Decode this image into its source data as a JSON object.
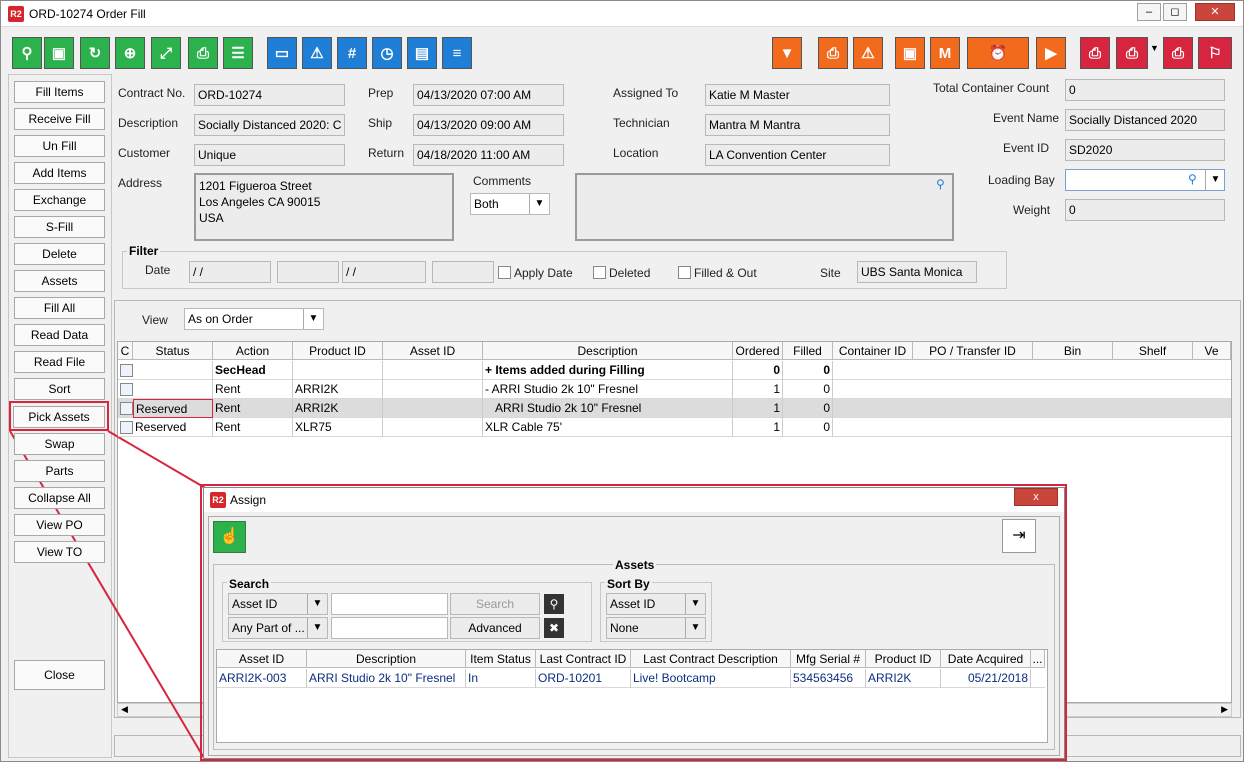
{
  "window": {
    "title": "ORD-10274 Order Fill",
    "logo": "R2"
  },
  "toolbar": {
    "left_icons": [
      "search-icon",
      "hand-truck-icon",
      "refresh-icon",
      "zoom-in-icon",
      "expand-icon",
      "print-icon",
      "layers-icon",
      "tablet-icon",
      "warning-eye-icon",
      "hash-icon",
      "gauge-icon",
      "comment-icon",
      "list-icon"
    ],
    "right_icons": [
      "filter-icon",
      "print-icon",
      "print-warning-icon",
      "box-warning-icon",
      "box-m-icon",
      "truck-clock-icon",
      "truck-icon",
      "print-red-icon",
      "print-red-2-icon",
      "print-red-3-icon",
      "print-tag-icon"
    ],
    "hash_glyph": "#"
  },
  "sidebar": {
    "items": [
      "Fill Items",
      "Receive Fill",
      "Un Fill",
      "Add Items",
      "Exchange",
      "S-Fill",
      "Delete",
      "Assets",
      "Fill  All",
      "Read Data",
      "Read File",
      "Sort",
      "Pick Assets",
      "Swap",
      "Parts",
      "Collapse All",
      "View PO",
      "View TO"
    ],
    "close": "Close"
  },
  "form": {
    "contract_no_label": "Contract No.",
    "contract_no": "ORD-10274",
    "description_label": "Description",
    "description": "Socially Distanced 2020: C",
    "customer_label": "Customer",
    "customer": "Unique",
    "address_label": "Address",
    "address_lines": [
      "1201 Figueroa Street",
      "Los Angeles CA 90015",
      "USA"
    ],
    "prep_label": "Prep",
    "prep": "04/13/2020 07:00 AM",
    "ship_label": "Ship",
    "ship": "04/13/2020 09:00 AM",
    "return_label": "Return",
    "return": "04/18/2020 11:00 AM",
    "comments_label": "Comments",
    "comments_select": "Both",
    "assigned_to_label": "Assigned To",
    "assigned_to": "Katie M Master",
    "technician_label": "Technician",
    "technician": "Mantra M Mantra",
    "location_label": "Location",
    "location": "LA Convention Center",
    "total_container_label": "Total Container Count",
    "total_container": "0",
    "event_name_label": "Event Name",
    "event_name": "Socially Distanced 2020",
    "event_id_label": "Event ID",
    "event_id": "SD2020",
    "loading_bay_label": "Loading Bay",
    "loading_bay": "",
    "weight_label": "Weight",
    "weight": "0"
  },
  "filter": {
    "title": "Filter",
    "date_label": "Date",
    "date_from": "/ /",
    "date_to": "/ /",
    "apply_date": "Apply Date",
    "deleted": "Deleted",
    "filled_out": "Filled & Out",
    "site_label": "Site",
    "site": "UBS Santa Monica"
  },
  "grid": {
    "view_label": "View",
    "view_value": "As on Order",
    "columns": [
      "C",
      "Status",
      "Action",
      "Product ID",
      "Asset ID",
      "Description",
      "Ordered",
      "Filled",
      "Container ID",
      "PO / Transfer ID",
      "Bin",
      "Shelf",
      "Ve"
    ],
    "rows": [
      {
        "status": "",
        "action": "SecHead",
        "product": "",
        "asset": "",
        "desc": "+ Items added during Filling",
        "ordered": "0",
        "filled": "0",
        "bold": true
      },
      {
        "status": "",
        "action": "Rent",
        "product": "ARRI2K",
        "asset": "",
        "desc": "- ARRI Studio 2k 10\" Fresnel",
        "ordered": "1",
        "filled": "0"
      },
      {
        "status": "Reserved",
        "action": "Rent",
        "product": "ARRI2K",
        "asset": "",
        "desc": "   ARRI Studio 2k 10\" Fresnel",
        "ordered": "1",
        "filled": "0",
        "selected": true
      },
      {
        "status": "Reserved",
        "action": "Rent",
        "product": "XLR75",
        "asset": "",
        "desc": "XLR Cable 75'",
        "ordered": "1",
        "filled": "0"
      }
    ]
  },
  "assign": {
    "title": "Assign",
    "logo": "R2",
    "close_glyph": "x",
    "assets_label": "Assets",
    "search_label": "Search",
    "search_field1": "Asset ID",
    "search_field2": "Any Part of ...",
    "search_btn": "Search",
    "advanced_btn": "Advanced",
    "sort_label": "Sort By",
    "sort1": "Asset ID",
    "sort2": "None",
    "columns": [
      "Asset ID",
      "Description",
      "Item Status",
      "Last Contract ID",
      "Last Contract Description",
      "Mfg Serial #",
      "Product ID",
      "Date Acquired",
      "..."
    ],
    "rows": [
      {
        "asset_id": "ARRI2K-003",
        "description": "ARRI Studio 2k 10\" Fresnel",
        "status": "In",
        "last_contract": "ORD-10201",
        "last_desc": "Live! Bootcamp",
        "serial": "534563456",
        "product": "ARRI2K",
        "date": "05/21/2018"
      }
    ]
  },
  "colors": {
    "green": "#2bb24c",
    "blue": "#1f7fd6",
    "orange": "#f26a1b",
    "red": "#d8253f",
    "highlight": "#d8253f"
  }
}
